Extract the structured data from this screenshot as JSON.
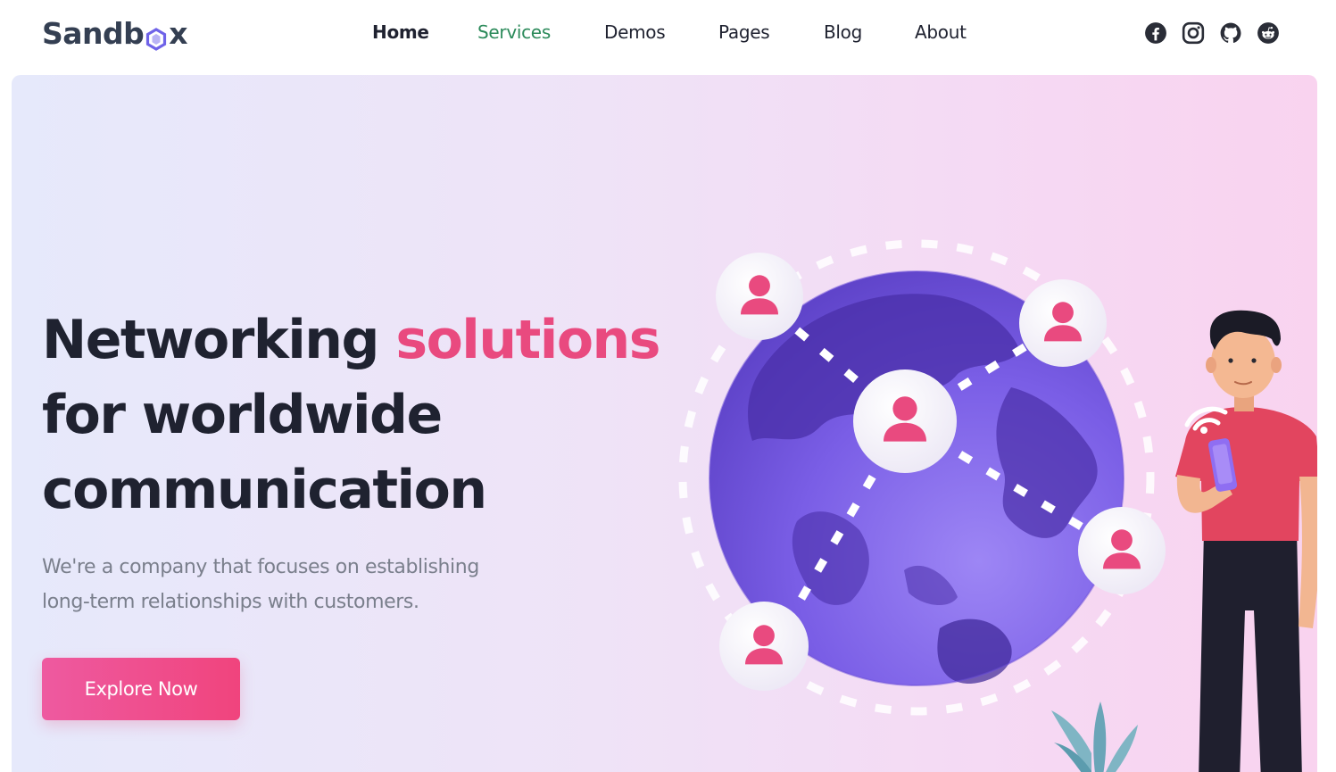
{
  "brand": {
    "logo_text_start": "Sandb",
    "logo_text_end": "x",
    "accent_color": "#e94a7f",
    "logo_hex_color": "#6f63e8"
  },
  "nav": {
    "items": [
      {
        "label": "Home"
      },
      {
        "label": "Services"
      },
      {
        "label": "Demos"
      },
      {
        "label": "Pages"
      },
      {
        "label": "Blog"
      },
      {
        "label": "About"
      }
    ],
    "active_color": "#2b8a5a",
    "social_icons": [
      "facebook-icon",
      "instagram-icon",
      "github-icon",
      "reddit-icon"
    ]
  },
  "hero": {
    "title_line1_plain": "Networking ",
    "title_line1_accent": "solutions",
    "title_line2": "for worldwide",
    "title_line3": "communication",
    "subtitle_line1": "We're a company that focuses on establishing",
    "subtitle_line2": "long-term relationships with customers.",
    "cta_label": "Explore Now",
    "illustration_icons": [
      "globe-illustration",
      "user-avatar-icon",
      "person-with-phone-illustration",
      "plant-illustration"
    ]
  }
}
